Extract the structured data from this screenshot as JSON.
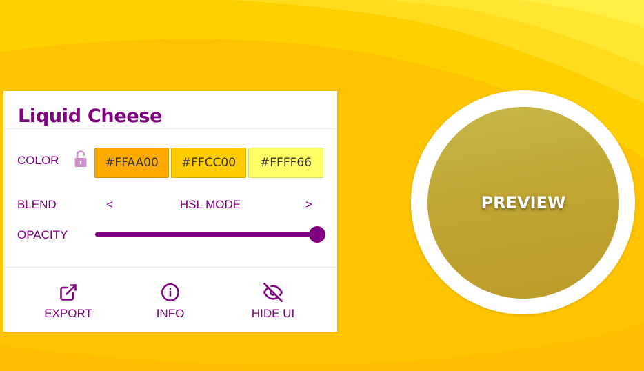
{
  "app": {
    "title": "Liquid Cheese",
    "background_colors": [
      "#FFAA00",
      "#FFCC00",
      "#FFFF66"
    ]
  },
  "controls": {
    "color_label": "COLOR",
    "lock_icon": "unlock-icon",
    "lock_state": "unlocked",
    "swatches": [
      {
        "hex": "#FFAA00",
        "color": "#FFAA00"
      },
      {
        "hex": "#FFCC00",
        "color": "#FFCC00"
      },
      {
        "hex": "#FFFF66",
        "color": "#FFFF66"
      }
    ],
    "blend_label": "BLEND",
    "blend_prev": "<",
    "blend_next": ">",
    "blend_mode": "HSL MODE",
    "opacity_label": "OPACITY",
    "opacity_value": 1.0
  },
  "actions": {
    "export": {
      "label": "EXPORT",
      "icon": "external-link-icon"
    },
    "info": {
      "label": "INFO",
      "icon": "info-icon"
    },
    "hide_ui": {
      "label": "HIDE UI",
      "icon": "eye-off-icon"
    }
  },
  "preview": {
    "label": "PREVIEW",
    "accent": "#800080"
  }
}
